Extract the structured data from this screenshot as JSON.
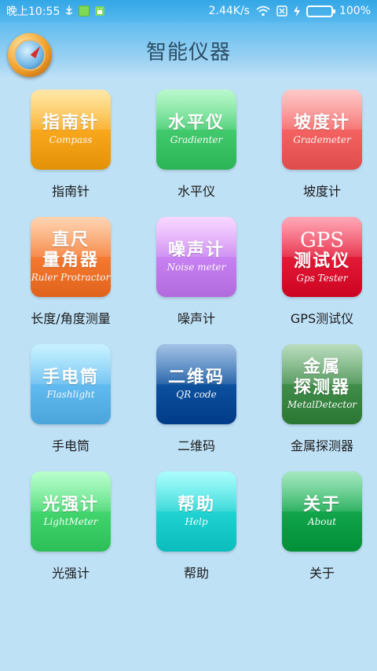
{
  "status_bar": {
    "time": "晚上10:55",
    "speed": "2.44K/s",
    "battery": "100%",
    "battery_level": 1.0
  },
  "header": {
    "title": "智能仪器",
    "logo_icon": "compass-icon"
  },
  "colors": {
    "status_bar": "#33a7e6",
    "background": "#bfe1f6"
  },
  "tiles": [
    {
      "cn": "指南针",
      "en": "Compass",
      "label": "指南针",
      "color": "#f7a51a",
      "icon": "compass-icon"
    },
    {
      "cn": "水平仪",
      "en": "Gradienter",
      "label": "水平仪",
      "color": "#3fc86a",
      "icon": "level-icon"
    },
    {
      "cn": "坡度计",
      "en": "Grademeter",
      "label": "坡度计",
      "color": "#f2605f",
      "icon": "grademeter-icon"
    },
    {
      "cn": "直尺\n量角器",
      "en": "Ruler Protractor",
      "label": "长度/角度测量",
      "color": "#f3772f",
      "icon": "ruler-icon"
    },
    {
      "cn": "噪声计",
      "en": "Noise meter",
      "label": "噪声计",
      "color": "#c57ff0",
      "icon": "noise-meter-icon"
    },
    {
      "cn": "GPS\n测试仪",
      "en": "Gps Tester",
      "label": "GPS测试仪",
      "color": "#e01835",
      "icon": "gps-icon"
    },
    {
      "cn": "手电筒",
      "en": "Flashlight",
      "label": "手电筒",
      "color": "#5fb8ee",
      "icon": "flashlight-icon"
    },
    {
      "cn": "二维码",
      "en": "QR code",
      "label": "二维码",
      "color": "#0b4f9c",
      "icon": "qr-code-icon"
    },
    {
      "cn": "金属\n探测器",
      "en": "MetalDetector",
      "label": "金属探测器",
      "color": "#3e8a47",
      "icon": "metal-detector-icon"
    },
    {
      "cn": "光强计",
      "en": "LightMeter",
      "label": "光强计",
      "color": "#40d36b",
      "icon": "light-meter-icon"
    },
    {
      "cn": "帮助",
      "en": "Help",
      "label": "帮助",
      "color": "#1ed0cf",
      "icon": "help-icon"
    },
    {
      "cn": "关于",
      "en": "About",
      "label": "关于",
      "color": "#10a34a",
      "icon": "about-icon"
    }
  ]
}
